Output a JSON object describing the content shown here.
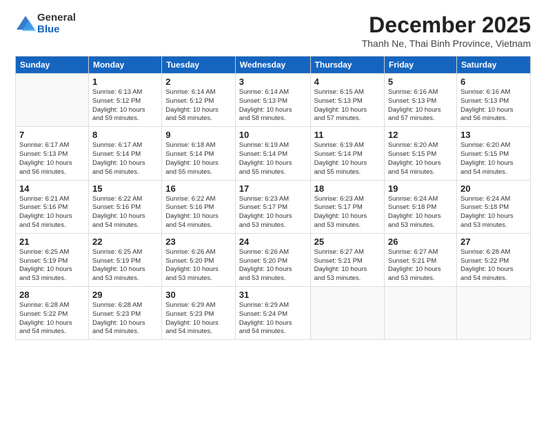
{
  "logo": {
    "general": "General",
    "blue": "Blue"
  },
  "header": {
    "month": "December 2025",
    "location": "Thanh Ne, Thai Binh Province, Vietnam"
  },
  "weekdays": [
    "Sunday",
    "Monday",
    "Tuesday",
    "Wednesday",
    "Thursday",
    "Friday",
    "Saturday"
  ],
  "weeks": [
    [
      {
        "day": "",
        "info": ""
      },
      {
        "day": "1",
        "info": "Sunrise: 6:13 AM\nSunset: 5:12 PM\nDaylight: 10 hours\nand 59 minutes."
      },
      {
        "day": "2",
        "info": "Sunrise: 6:14 AM\nSunset: 5:12 PM\nDaylight: 10 hours\nand 58 minutes."
      },
      {
        "day": "3",
        "info": "Sunrise: 6:14 AM\nSunset: 5:13 PM\nDaylight: 10 hours\nand 58 minutes."
      },
      {
        "day": "4",
        "info": "Sunrise: 6:15 AM\nSunset: 5:13 PM\nDaylight: 10 hours\nand 57 minutes."
      },
      {
        "day": "5",
        "info": "Sunrise: 6:16 AM\nSunset: 5:13 PM\nDaylight: 10 hours\nand 57 minutes."
      },
      {
        "day": "6",
        "info": "Sunrise: 6:16 AM\nSunset: 5:13 PM\nDaylight: 10 hours\nand 56 minutes."
      }
    ],
    [
      {
        "day": "7",
        "info": "Sunrise: 6:17 AM\nSunset: 5:13 PM\nDaylight: 10 hours\nand 56 minutes."
      },
      {
        "day": "8",
        "info": "Sunrise: 6:17 AM\nSunset: 5:14 PM\nDaylight: 10 hours\nand 56 minutes."
      },
      {
        "day": "9",
        "info": "Sunrise: 6:18 AM\nSunset: 5:14 PM\nDaylight: 10 hours\nand 55 minutes."
      },
      {
        "day": "10",
        "info": "Sunrise: 6:19 AM\nSunset: 5:14 PM\nDaylight: 10 hours\nand 55 minutes."
      },
      {
        "day": "11",
        "info": "Sunrise: 6:19 AM\nSunset: 5:14 PM\nDaylight: 10 hours\nand 55 minutes."
      },
      {
        "day": "12",
        "info": "Sunrise: 6:20 AM\nSunset: 5:15 PM\nDaylight: 10 hours\nand 54 minutes."
      },
      {
        "day": "13",
        "info": "Sunrise: 6:20 AM\nSunset: 5:15 PM\nDaylight: 10 hours\nand 54 minutes."
      }
    ],
    [
      {
        "day": "14",
        "info": "Sunrise: 6:21 AM\nSunset: 5:16 PM\nDaylight: 10 hours\nand 54 minutes."
      },
      {
        "day": "15",
        "info": "Sunrise: 6:22 AM\nSunset: 5:16 PM\nDaylight: 10 hours\nand 54 minutes."
      },
      {
        "day": "16",
        "info": "Sunrise: 6:22 AM\nSunset: 5:16 PM\nDaylight: 10 hours\nand 54 minutes."
      },
      {
        "day": "17",
        "info": "Sunrise: 6:23 AM\nSunset: 5:17 PM\nDaylight: 10 hours\nand 53 minutes."
      },
      {
        "day": "18",
        "info": "Sunrise: 6:23 AM\nSunset: 5:17 PM\nDaylight: 10 hours\nand 53 minutes."
      },
      {
        "day": "19",
        "info": "Sunrise: 6:24 AM\nSunset: 5:18 PM\nDaylight: 10 hours\nand 53 minutes."
      },
      {
        "day": "20",
        "info": "Sunrise: 6:24 AM\nSunset: 5:18 PM\nDaylight: 10 hours\nand 53 minutes."
      }
    ],
    [
      {
        "day": "21",
        "info": "Sunrise: 6:25 AM\nSunset: 5:19 PM\nDaylight: 10 hours\nand 53 minutes."
      },
      {
        "day": "22",
        "info": "Sunrise: 6:25 AM\nSunset: 5:19 PM\nDaylight: 10 hours\nand 53 minutes."
      },
      {
        "day": "23",
        "info": "Sunrise: 6:26 AM\nSunset: 5:20 PM\nDaylight: 10 hours\nand 53 minutes."
      },
      {
        "day": "24",
        "info": "Sunrise: 6:26 AM\nSunset: 5:20 PM\nDaylight: 10 hours\nand 53 minutes."
      },
      {
        "day": "25",
        "info": "Sunrise: 6:27 AM\nSunset: 5:21 PM\nDaylight: 10 hours\nand 53 minutes."
      },
      {
        "day": "26",
        "info": "Sunrise: 6:27 AM\nSunset: 5:21 PM\nDaylight: 10 hours\nand 53 minutes."
      },
      {
        "day": "27",
        "info": "Sunrise: 6:28 AM\nSunset: 5:22 PM\nDaylight: 10 hours\nand 54 minutes."
      }
    ],
    [
      {
        "day": "28",
        "info": "Sunrise: 6:28 AM\nSunset: 5:22 PM\nDaylight: 10 hours\nand 54 minutes."
      },
      {
        "day": "29",
        "info": "Sunrise: 6:28 AM\nSunset: 5:23 PM\nDaylight: 10 hours\nand 54 minutes."
      },
      {
        "day": "30",
        "info": "Sunrise: 6:29 AM\nSunset: 5:23 PM\nDaylight: 10 hours\nand 54 minutes."
      },
      {
        "day": "31",
        "info": "Sunrise: 6:29 AM\nSunset: 5:24 PM\nDaylight: 10 hours\nand 54 minutes."
      },
      {
        "day": "",
        "info": ""
      },
      {
        "day": "",
        "info": ""
      },
      {
        "day": "",
        "info": ""
      }
    ]
  ]
}
